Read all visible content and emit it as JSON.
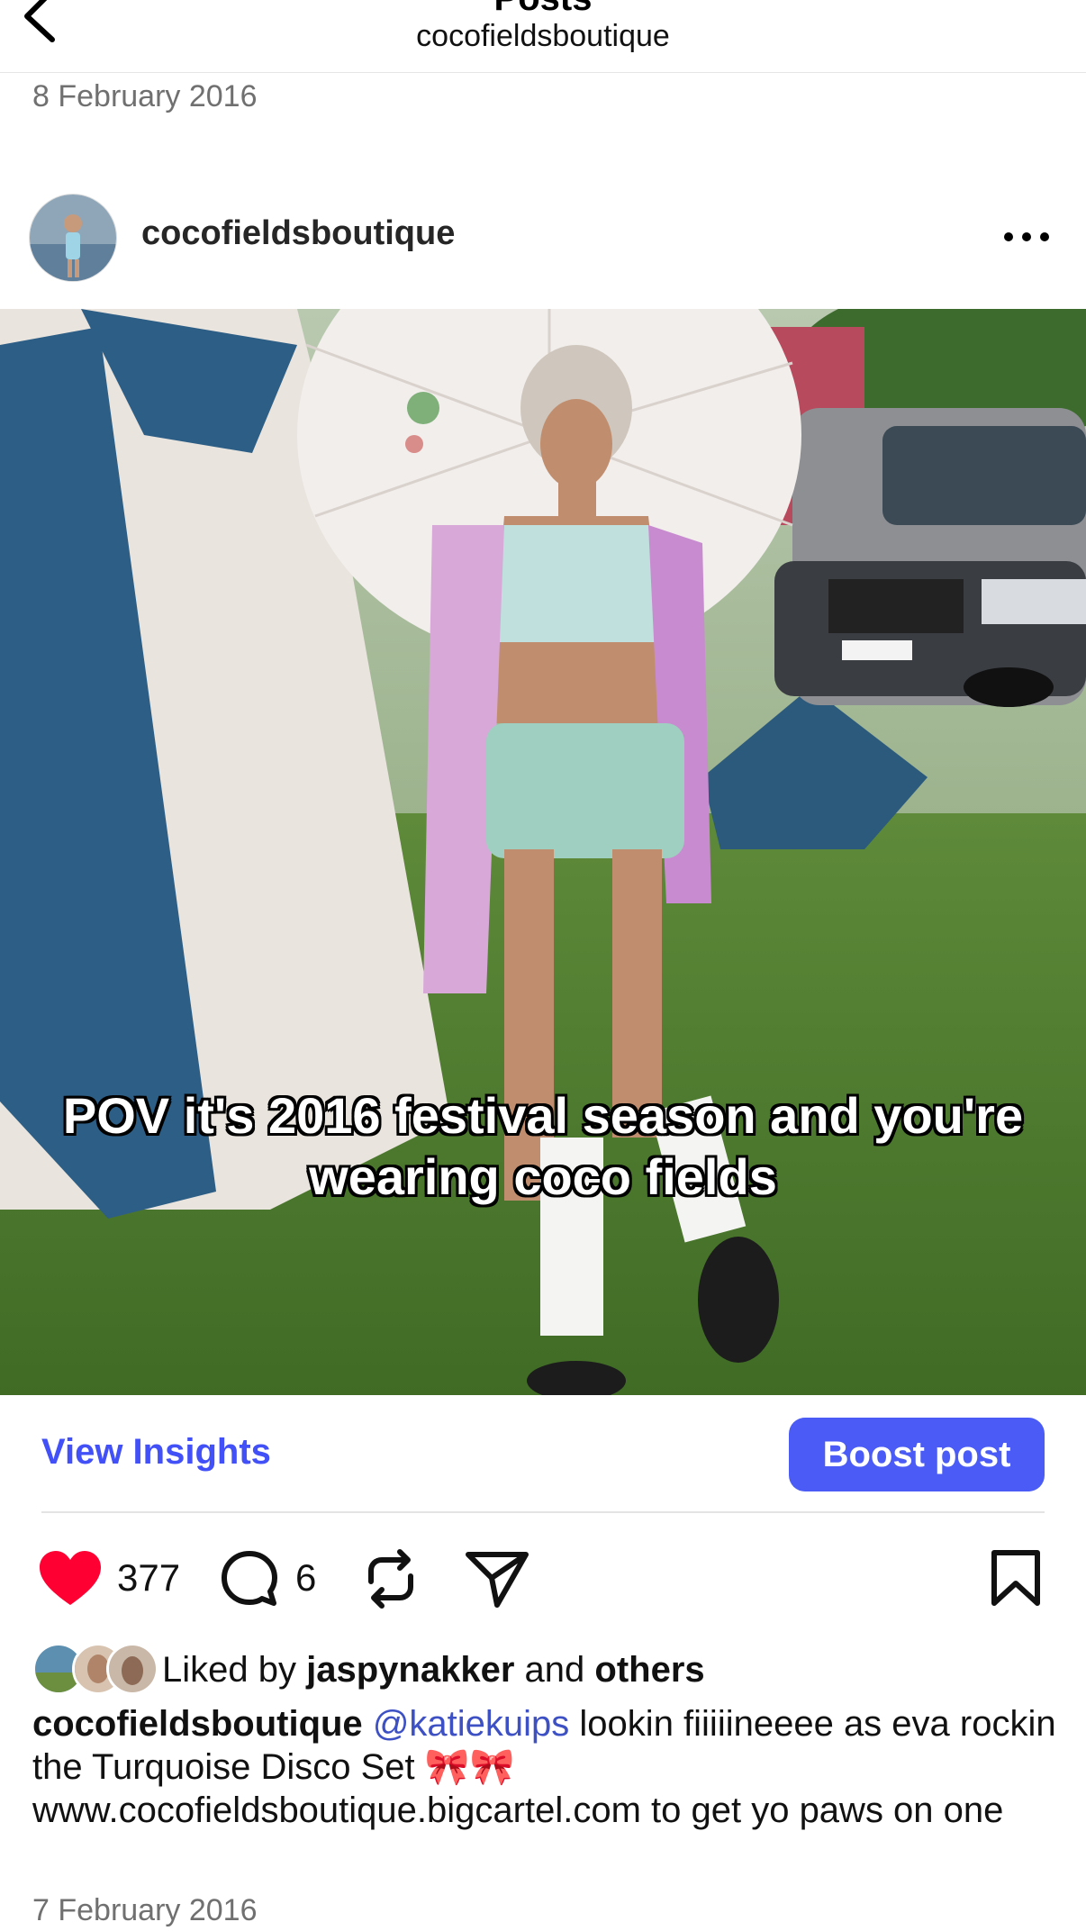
{
  "header": {
    "title": "Posts",
    "account": "cocofieldsboutique"
  },
  "previous_post_date": "8 February 2016",
  "post": {
    "username": "cocofieldsboutique",
    "image_overlay_text_line1": "POV it's 2016 festival season and you're",
    "image_overlay_text_line2": "wearing coco fields",
    "insights_label": "View Insights",
    "boost_label": "Boost post",
    "likes": "377",
    "comments": "6",
    "liked_by_prefix": "Liked by",
    "liked_by_user": "jaspynakker",
    "liked_by_and": "and",
    "liked_by_others": "others",
    "caption_user": "cocofieldsboutique",
    "caption_mention": "@katiekuips",
    "caption_text": "lookin fiiiiineeee as eva rockin the Turquoise Disco Set 🎀🎀 www.cocofieldsboutique.bigcartel.com to get yo paws on one",
    "date": "7 February 2016"
  },
  "colors": {
    "accent": "#4a5cf5",
    "like": "#ff0033",
    "link": "#3d50c4"
  },
  "icons": [
    "back-arrow-icon",
    "more-icon",
    "heart-icon",
    "comment-icon",
    "repost-icon",
    "share-icon",
    "bookmark-icon"
  ]
}
